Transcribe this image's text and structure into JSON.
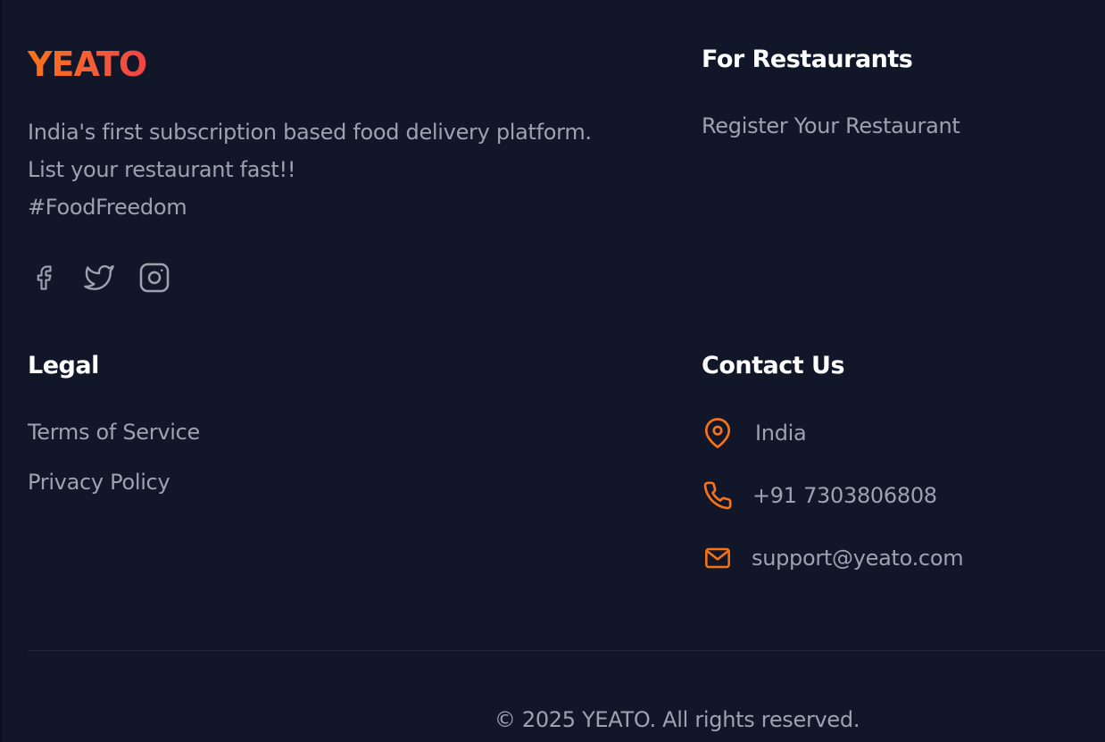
{
  "brand": {
    "logo_text": "YEATO",
    "about_lines": [
      "India's first subscription based food delivery platform.",
      "List your restaurant fast!!",
      "#FoodFreedom"
    ],
    "colors": {
      "logo_start": "#f97316",
      "logo_end": "#ef4444",
      "accent": "#f97316",
      "background": "#111729"
    }
  },
  "social": [
    {
      "name": "facebook",
      "icon": "facebook-icon"
    },
    {
      "name": "twitter",
      "icon": "twitter-icon"
    },
    {
      "name": "instagram",
      "icon": "instagram-icon"
    }
  ],
  "restaurants": {
    "heading": "For Restaurants",
    "links": [
      "Register Your Restaurant"
    ]
  },
  "legal": {
    "heading": "Legal",
    "links": [
      "Terms of Service",
      "Privacy Policy"
    ]
  },
  "contact": {
    "heading": "Contact Us",
    "items": [
      {
        "icon": "map-pin-icon",
        "text": "India"
      },
      {
        "icon": "phone-icon",
        "text": "+91 7303806808"
      },
      {
        "icon": "mail-icon",
        "text": "support@yeato.com"
      }
    ]
  },
  "footer": {
    "copyright": "© 2025 YEATO. All rights reserved."
  }
}
